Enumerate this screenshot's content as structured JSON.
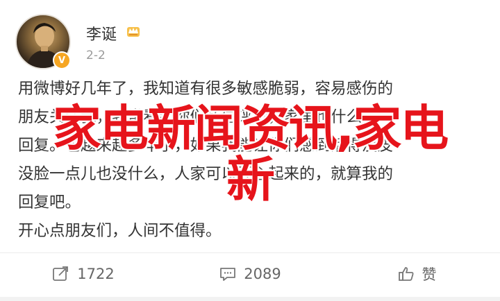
{
  "post": {
    "author": {
      "name": "李诞",
      "avatar_icon": "avatar-portrait",
      "verified_icon": "verified-v-icon",
      "badge_icon": "crown-badge-icon"
    },
    "time": "2-2",
    "content_lines": [
      "用微博好几年了，我知道有很多敏感脆弱，容易感伤的",
      "朋友关注我，我常看到你们私信评论，家里也什么",
      "回复。也越来越多年了，如果我能让你们感到活得没皮",
      "没脸一点儿也没什么，人家可以开心起来的，就算我的",
      "回复吧。",
      "开心点朋友们，人间不值得。"
    ],
    "watermark_lines": [
      "家电新闻资讯,家电",
      "新"
    ],
    "watermark_color": "#e6141b"
  },
  "actions": {
    "repost": {
      "icon": "repost-icon",
      "count": "1722"
    },
    "comment": {
      "icon": "comment-icon",
      "count": "2089"
    },
    "like": {
      "icon": "thumbs-up-icon",
      "label": "赞"
    }
  }
}
